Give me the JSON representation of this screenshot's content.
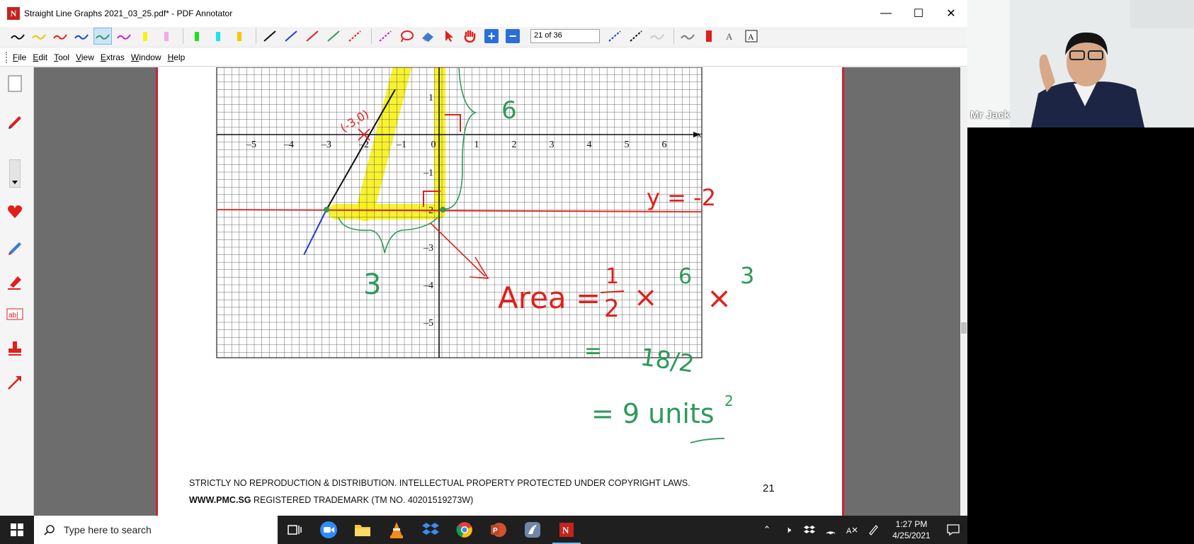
{
  "window": {
    "title": "Straight Line Graphs 2021_03_25.pdf* - PDF Annotator",
    "minimize_glyph": "—",
    "maximize_glyph": "☐",
    "close_glyph": "✕"
  },
  "toolbar": {
    "page_nav": "21 of 36",
    "plus_glyph": "+",
    "minus_glyph": "−"
  },
  "menu": [
    "File",
    "Edit",
    "Tool",
    "View",
    "Extras",
    "Window",
    "Help"
  ],
  "document": {
    "footer_line1": "STRICTLY NO REPRODUCTION & DISTRIBUTION. INTELLECTUAL PROPERTY PROTECTED UNDER COPYRIGHT LAWS.",
    "footer_url": "WWW.PMC.SG",
    "footer_tm": " REGISTERED TRADEMARK (TM NO. 40201519273W)",
    "page_number": "21",
    "graph": {
      "x_ticks": [
        "–5",
        "–4",
        "–3",
        "–2",
        "–1",
        "0",
        "1",
        "2",
        "3",
        "4",
        "5",
        "6"
      ],
      "y_ticks": [
        "1",
        "–1",
        "–2",
        "–3",
        "–4",
        "–5"
      ],
      "x_label": "x"
    },
    "annotations": {
      "point": "(-3,0)",
      "line_label": "y = -2",
      "side_6": "6",
      "side_3": "3",
      "area_text": "Area =",
      "half_num": "1",
      "half_den": "2",
      "times1": "×",
      "times2": "×",
      "factor6": "6",
      "factor3": "3",
      "eq2": "=",
      "frac_text": "18/2",
      "result": "= 9 units",
      "result_exp": "2"
    }
  },
  "video": {
    "speaker_name": "Mr Jack"
  },
  "taskbar": {
    "search_placeholder": "Type here to search",
    "time": "1:27 PM",
    "date": "4/25/2021"
  },
  "colors": {
    "red": "#e0201b",
    "yellow": "#f7f218",
    "green": "#2e9a5b",
    "grid": "#444444"
  }
}
